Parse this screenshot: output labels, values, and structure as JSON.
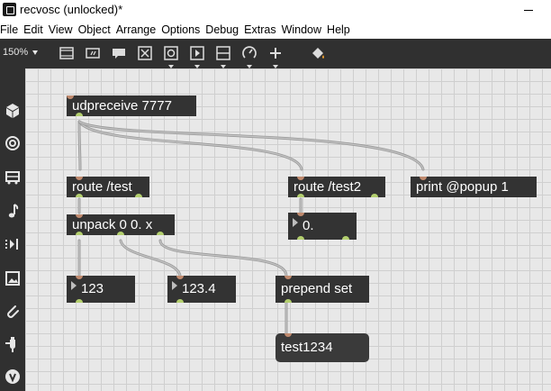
{
  "window": {
    "title": "recvosc (unlocked)*"
  },
  "menu": [
    "File",
    "Edit",
    "View",
    "Object",
    "Arrange",
    "Options",
    "Debug",
    "Extras",
    "Window",
    "Help"
  ],
  "toolbar": {
    "zoom": "150%",
    "buttons": [
      "presentation-icon",
      "text-edit-icon",
      "comment-icon",
      "close-box-icon",
      "button-object-icon",
      "play-object-icon",
      "slider-object-icon",
      "dial-object-icon",
      "add-icon",
      "paint-bucket-icon"
    ]
  },
  "sidebar": {
    "icons": [
      "package-icon",
      "target-icon",
      "bus-icon",
      "music-note-icon",
      "sequencer-icon",
      "image-icon",
      "paperclip-icon",
      "plug-icon",
      "vizzie-icon"
    ]
  },
  "colors": {
    "canvas": "#e8e8e8",
    "object": "#333333",
    "inlet": "#c08a6e",
    "outlet": "#b3cf6e",
    "cable": "#a8a8a8"
  },
  "patch": {
    "udpreceive": "udpreceive 7777",
    "route_test": "route /test",
    "route_test2": "route /test2",
    "print": "print @popup 1",
    "unpack": "unpack 0 0. x",
    "num_float_right": "0.",
    "num_int": "123",
    "num_float": "123.4",
    "prepend": "prepend set",
    "message": "test1234"
  }
}
